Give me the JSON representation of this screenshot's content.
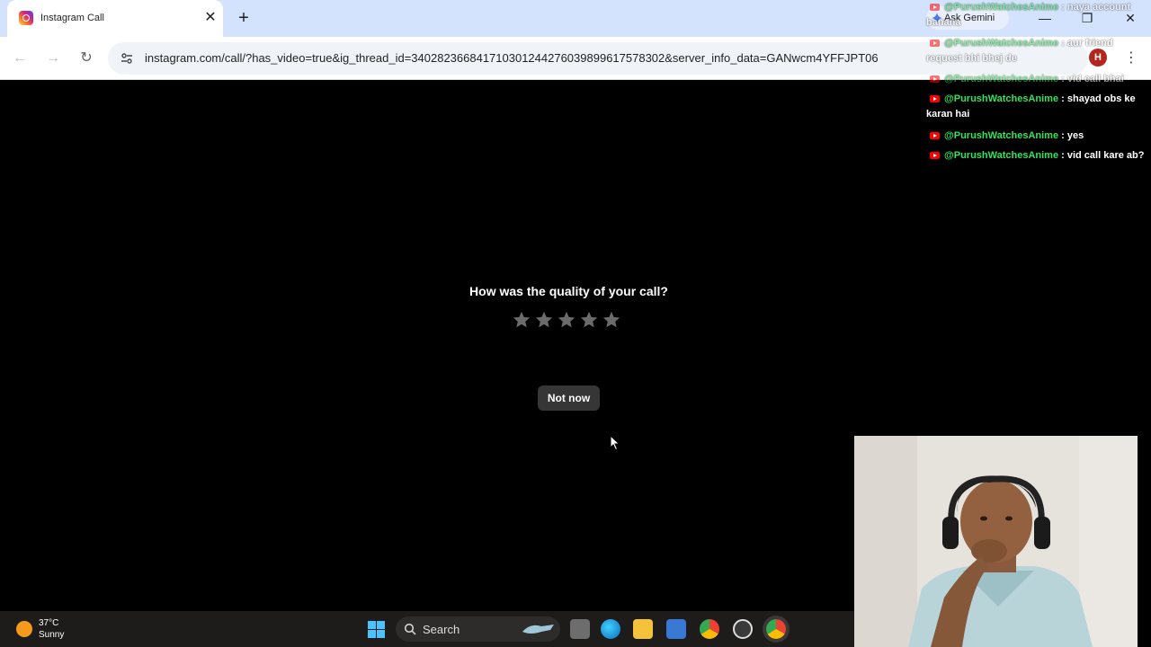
{
  "browser": {
    "tab_title": "Instagram Call",
    "tab_close_glyph": "✕",
    "new_tab_glyph": "+",
    "ask_gemini_label": "Ask Gemini",
    "url": "instagram.com/call/?has_video=true&ig_thread_id=340282366841710301244276039899617578302&server_info_data=GANwcm4YFFJPT06",
    "profile_initial": "H",
    "minimize_glyph": "—",
    "restore_glyph": "❐",
    "close_glyph": "✕"
  },
  "call_feedback": {
    "question": "How was the quality of your call?",
    "rating_max": 5,
    "rating_value": 0,
    "not_now_label": "Not now"
  },
  "live_chat": [
    {
      "user": "@PurushWatchesAnime",
      "text": " : naya account banana",
      "faded": true
    },
    {
      "user": "@PurushWatchesAnime",
      "text": " : aur friend request bhi bhej de",
      "faded": true
    },
    {
      "user": "@PurushWatchesAnime",
      "text": " : vid call bhai",
      "faded": true
    },
    {
      "user": "@PurushWatchesAnime",
      "text": " : shayad obs ke karan hai",
      "faded": false
    },
    {
      "user": "@PurushWatchesAnime",
      "text": " : yes",
      "faded": false
    },
    {
      "user": "@PurushWatchesAnime",
      "text": " : vid call kare ab?",
      "faded": false
    }
  ],
  "taskbar": {
    "temperature": "37°C",
    "condition": "Sunny",
    "search_label": "Search"
  },
  "colors": {
    "page_bg": "#000000",
    "star_empty": "#6b6b6b",
    "button_bg": "#363636",
    "chat_username": "#30e35a",
    "tab_strip": "#d3e3fd"
  }
}
